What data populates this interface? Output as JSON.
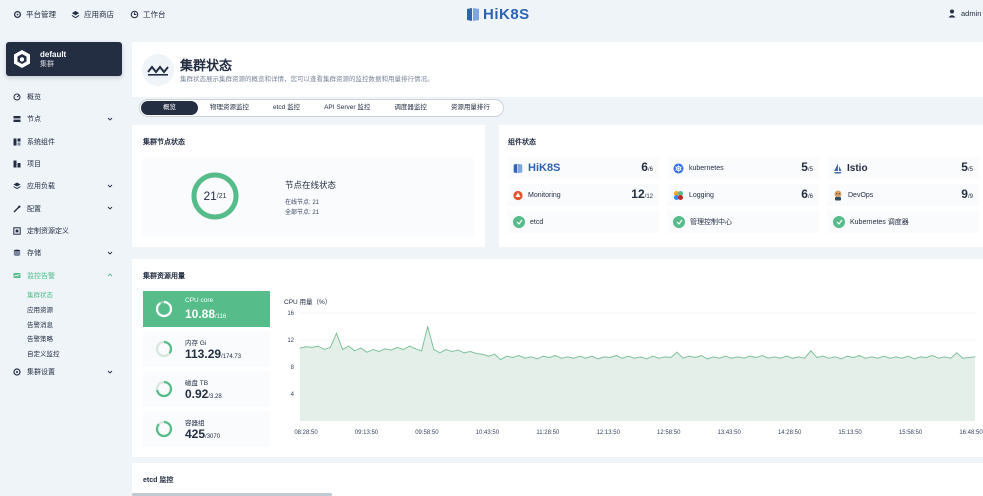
{
  "topbar": {
    "platform_label": "平台管理",
    "appstore_label": "应用商店",
    "workbench_label": "工作台",
    "logo_text": "HiK8S",
    "user": "admin"
  },
  "sidebar": {
    "cluster_name": "default",
    "cluster_type": "集群",
    "items": [
      {
        "label": "概览",
        "icon": "dashboard-icon",
        "expandable": false
      },
      {
        "label": "节点",
        "icon": "node-icon",
        "expandable": true
      },
      {
        "label": "系统组件",
        "icon": "components-icon",
        "expandable": false
      },
      {
        "label": "项目",
        "icon": "project-icon",
        "expandable": false
      },
      {
        "label": "应用负载",
        "icon": "workload-icon",
        "expandable": true
      },
      {
        "label": "配置",
        "icon": "config-icon",
        "expandable": true
      },
      {
        "label": "定制资源定义",
        "icon": "crd-icon",
        "expandable": false
      },
      {
        "label": "存储",
        "icon": "storage-icon",
        "expandable": true
      },
      {
        "label": "监控告警",
        "icon": "monitor-icon",
        "expandable": true,
        "active": true
      }
    ],
    "sub_items": [
      {
        "label": "集群状态",
        "active": true
      },
      {
        "label": "应用资源"
      },
      {
        "label": "告警消息"
      },
      {
        "label": "告警策略"
      },
      {
        "label": "自定义监控"
      }
    ],
    "last_item": {
      "label": "集群设置",
      "icon": "settings-icon",
      "expandable": true
    }
  },
  "header": {
    "title": "集群状态",
    "description": "集群状态展示集群资源的概览和详情，您可以查看集群资源的监控数据和用量排行情况。"
  },
  "tabs": [
    "概览",
    "物理资源监控",
    "etcd 监控",
    "API Server 监控",
    "调度器监控",
    "资源用量排行"
  ],
  "node_status": {
    "title": "集群节点状态",
    "online": "21",
    "total": "21",
    "label": "节点在线状态",
    "online_line": "在线节点: 21",
    "total_line": "全部节点: 21"
  },
  "components": {
    "title": "组件状态",
    "tiles": [
      {
        "name": "HiK8S",
        "count": "6",
        "total": "/6",
        "icon": "hik8s-logo-icon"
      },
      {
        "name": "kubernetes",
        "count": "5",
        "total": "/5",
        "icon": "kubernetes-icon"
      },
      {
        "name": "Istio",
        "count": "5",
        "total": "/5",
        "icon": "istio-icon"
      },
      {
        "name": "Monitoring",
        "count": "12",
        "total": "/12",
        "icon": "monitoring-icon"
      },
      {
        "name": "Logging",
        "count": "6",
        "total": "/6",
        "icon": "logging-icon"
      },
      {
        "name": "DevOps",
        "count": "9",
        "total": "/9",
        "icon": "devops-icon"
      },
      {
        "name": "etcd",
        "icon": "check-icon"
      },
      {
        "name": "管理控制中心",
        "icon": "check-icon"
      },
      {
        "name": "Kubernetes 调度器",
        "icon": "check-icon"
      }
    ]
  },
  "resources": {
    "title": "集群资源用量",
    "tiles": [
      {
        "label": "CPU core",
        "value": "10.88",
        "total": "/116",
        "fraction": 0.094,
        "active": true
      },
      {
        "label": "内存 Gi",
        "value": "113.29",
        "total": "/174.73",
        "fraction": 0.648
      },
      {
        "label": "磁盘 TB",
        "value": "0.92",
        "total": "/3.28",
        "fraction": 0.28
      },
      {
        "label": "容器组",
        "value": "425",
        "total": "/3070",
        "fraction": 0.138
      }
    ]
  },
  "etcd_title": "etcd 监控",
  "colors": {
    "accent": "#55bc8a",
    "dark": "#242e42",
    "brand": "#2d63b3"
  },
  "chart_data": {
    "type": "area",
    "title": "CPU 用量（%）",
    "ylim": [
      0,
      16
    ],
    "yticks": [
      4,
      8,
      12,
      16
    ],
    "xticks": [
      "08:28:50",
      "09:13:50",
      "09:58:50",
      "10:43:50",
      "11:28:50",
      "12:13:50",
      "12:58:50",
      "13:43:50",
      "14:28:50",
      "15:13:50",
      "15:58:50",
      "16:48:50"
    ],
    "series": [
      {
        "values": [
          10.8,
          11.0,
          10.9,
          11.1,
          10.6,
          10.9,
          13.0,
          10.6,
          11.1,
          10.4,
          10.8,
          10.2,
          10.6,
          10.3,
          10.7,
          10.5,
          10.9,
          10.6,
          11.1,
          10.7,
          10.4,
          14.0,
          10.6,
          10.1,
          10.6,
          10.3,
          10.5,
          10.1,
          10.3,
          10.0,
          9.9,
          9.6,
          9.9,
          9.1,
          9.6,
          9.4,
          9.7,
          9.3,
          9.5,
          9.2,
          9.6,
          9.4,
          9.7,
          9.3,
          9.5,
          9.3,
          9.6,
          9.3,
          9.6,
          9.2,
          9.5,
          9.4,
          9.7,
          9.3,
          9.6,
          9.3,
          9.5,
          9.2,
          9.6,
          9.3,
          9.5,
          9.4,
          10.2,
          9.3,
          9.6,
          9.4,
          9.7,
          9.2,
          9.5,
          9.3,
          9.6,
          9.3,
          9.5,
          9.3,
          9.6,
          9.4,
          9.7,
          9.3,
          9.5,
          9.3,
          9.6,
          9.3,
          9.5,
          9.3,
          10.4,
          9.4,
          9.6,
          9.3,
          9.5,
          9.2,
          9.6,
          9.4,
          9.7,
          9.3,
          9.5,
          9.3,
          9.6,
          9.3,
          9.5,
          9.3,
          9.6,
          9.2,
          9.5,
          9.4,
          9.7,
          9.3,
          9.5,
          9.3,
          10.1,
          9.3,
          9.4,
          9.5
        ]
      }
    ]
  }
}
